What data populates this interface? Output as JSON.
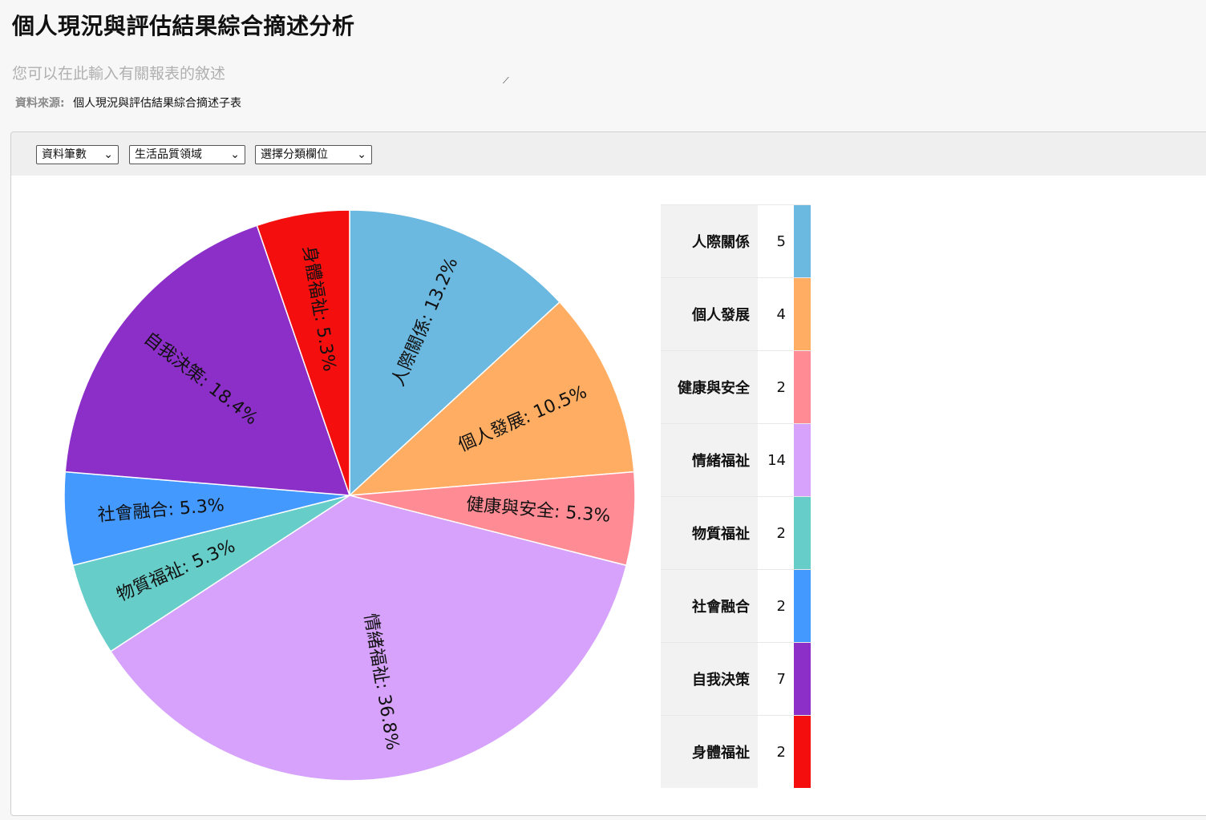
{
  "page": {
    "title": "個人現況與評估結果綜合摘述分析",
    "description_placeholder": "您可以在此輸入有關報表的敘述",
    "source_label": "資料來源:",
    "source_value": "個人現況與評估結果綜合摘述子表"
  },
  "toolbar": {
    "measure_select": "資料筆數",
    "domain_select": "生活品質領域",
    "category_select": "選擇分類欄位",
    "chevron_icon": "chevron-down-icon"
  },
  "chart_data": {
    "type": "pie",
    "categories": [
      "人際關係",
      "個人發展",
      "健康與安全",
      "情緒福祉",
      "物質福祉",
      "社會融合",
      "自我決策",
      "身體福祉"
    ],
    "values": [
      5,
      4,
      2,
      14,
      2,
      2,
      7,
      2
    ],
    "percent_labels": [
      "13.2%",
      "10.5%",
      "5.3%",
      "36.8%",
      "5.3%",
      "5.3%",
      "18.4%",
      "5.3%"
    ],
    "colors": [
      "#6bb8e0",
      "#ffad62",
      "#ff8b94",
      "#d6a2fc",
      "#66cdc8",
      "#4499ff",
      "#8c2ec8",
      "#f50e0e"
    ],
    "legend_placement": "right"
  }
}
